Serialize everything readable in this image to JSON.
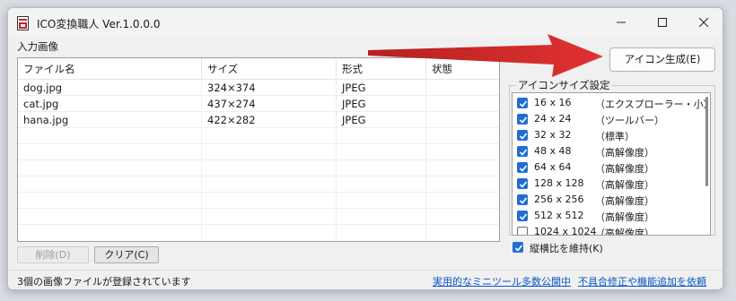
{
  "window": {
    "title": "ICO変換職人 Ver.1.0.0.0",
    "icons": [
      "app-icon",
      "minimize-icon",
      "maximize-icon",
      "close-icon"
    ]
  },
  "input_group": {
    "label": "入力画像",
    "columns": [
      "ファイル名",
      "サイズ",
      "形式",
      "状態"
    ],
    "rows": [
      {
        "name": "dog.jpg",
        "size": "324×374",
        "format": "JPEG",
        "state": ""
      },
      {
        "name": "cat.jpg",
        "size": "437×274",
        "format": "JPEG",
        "state": ""
      },
      {
        "name": "hana.jpg",
        "size": "422×282",
        "format": "JPEG",
        "state": ""
      }
    ],
    "delete_label": "削除(D)",
    "clear_label": "クリア(C)"
  },
  "generate_button": "アイコン生成(E)",
  "icon_sizes": {
    "label": "アイコンサイズ設定",
    "items": [
      {
        "size": "16 x 16",
        "desc": "（エクスプローラー・小）",
        "checked": true
      },
      {
        "size": "24 x 24",
        "desc": "（ツールバー）",
        "checked": true
      },
      {
        "size": "32 x 32",
        "desc": "（標準）",
        "checked": true
      },
      {
        "size": "48 x 48",
        "desc": "（高解像度）",
        "checked": true
      },
      {
        "size": "64 x 64",
        "desc": "（高解像度）",
        "checked": true
      },
      {
        "size": "128 x 128",
        "desc": "（高解像度）",
        "checked": true
      },
      {
        "size": "256 x 256",
        "desc": "（高解像度）",
        "checked": true
      },
      {
        "size": "512 x 512",
        "desc": "（高解像度）",
        "checked": true
      },
      {
        "size": "1024 x 1024",
        "desc": "（高解像度）",
        "checked": false
      }
    ],
    "keep_ratio_label": "縦横比を維持(K)",
    "keep_ratio_checked": true
  },
  "status_bar": {
    "text": "3個の画像ファイルが登録されています",
    "link1": "実用的なミニツール多数公開中",
    "link2": "不具合修正や機能追加を依頼"
  },
  "colors": {
    "checkbox": "#1f6fd1",
    "link": "#0b56c4",
    "arrow": "#d42a2a"
  }
}
